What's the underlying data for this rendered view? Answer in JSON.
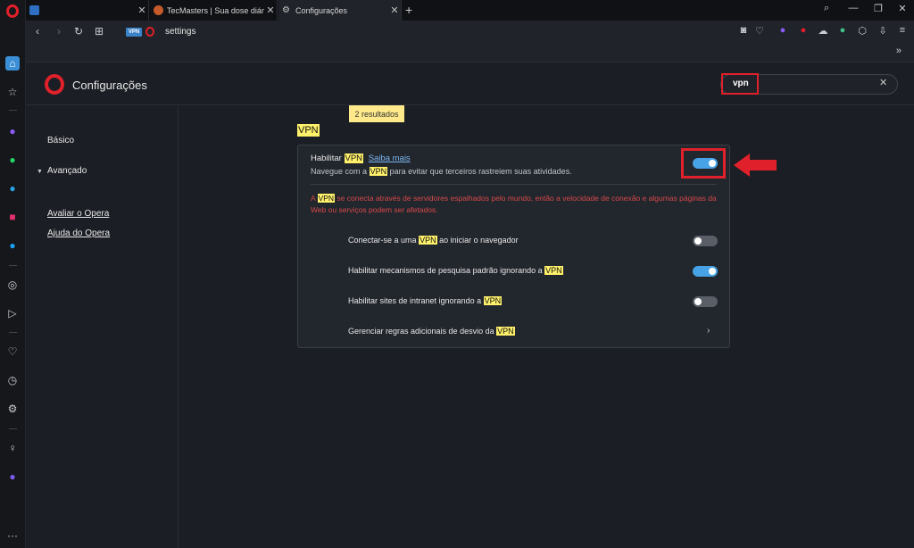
{
  "browser": {
    "tabs": [
      {
        "title": "",
        "favicon_color": "#2e6fc2"
      },
      {
        "title": "TecMasters | Sua dose diári",
        "favicon_color": "#c55a2b"
      },
      {
        "title": "Configurações",
        "favicon_color": "#9aa0a8"
      }
    ],
    "address": {
      "badge": "VPN",
      "url": "settings"
    }
  },
  "settings": {
    "title": "Configurações",
    "search_value": "vpn",
    "results": "2 resultados",
    "nav": {
      "basic": "Básico",
      "advanced": "Avançado",
      "rate": "Avaliar o Opera",
      "help": "Ajuda do Opera"
    },
    "section_title": "VPN",
    "vpn": {
      "enable_pre": "Habilitar",
      "enable_hl": "VPN",
      "learn_more": "Saiba mais",
      "desc_pre": "Navegue com a",
      "desc_hl": "VPN",
      "desc_post": "para evitar que terceiros rastreiem suas atividades.",
      "warn_pre": "A",
      "warn_hl": "VPN",
      "warn_post": "se conecta através de servidores espalhados pelo mundo, então a velocidade de conexão e algumas páginas da Web ou serviços podem ser afetados.",
      "opt1_pre": "Conectar-se a uma",
      "opt1_hl": "VPN",
      "opt1_post": "ao iniciar o navegador",
      "opt2_pre": "Habilitar mecanismos de pesquisa padrão ignorando a",
      "opt2_hl": "VPN",
      "opt3_pre": "Habilitar sites de intranet ignorando a",
      "opt3_hl": "VPN",
      "opt4_pre": "Gerenciar regras adicionais de desvio da",
      "opt4_hl": "VPN"
    },
    "toggles": {
      "enable_vpn": true,
      "connect_on_start": false,
      "search_bypass": true,
      "intranet_bypass": false
    }
  },
  "colors": {
    "accent": "#e0202a",
    "toggle_on": "#47a3e6",
    "highlight": "#fff16a"
  }
}
